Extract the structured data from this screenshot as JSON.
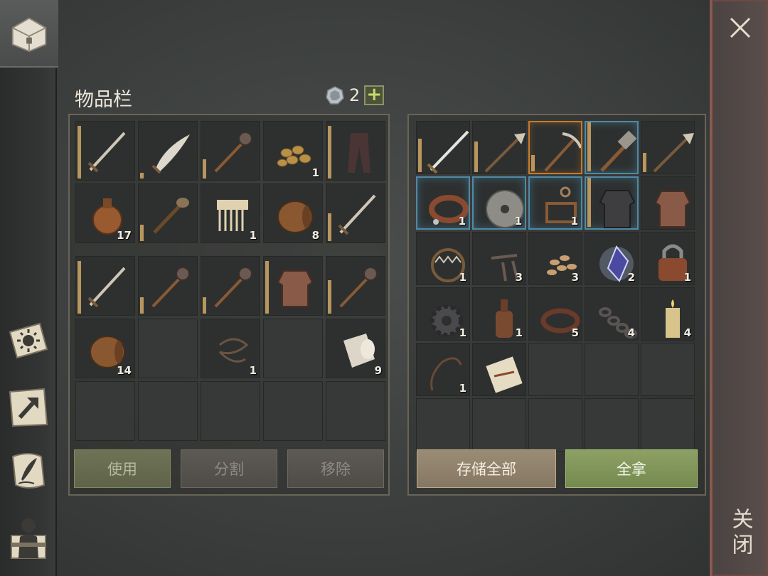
{
  "header": {
    "title": "物品栏",
    "coins": "2",
    "plus_label": "+"
  },
  "close": {
    "label": "关闭"
  },
  "sidebar": {
    "items": [
      {
        "name": "chest-tab",
        "icon": "chest-icon"
      },
      {
        "name": "sidebar-item-events",
        "icon": "sun-book-icon"
      },
      {
        "name": "sidebar-item-crafting",
        "icon": "hammer-scroll-icon"
      },
      {
        "name": "sidebar-item-journal",
        "icon": "quill-scroll-icon"
      },
      {
        "name": "sidebar-item-character",
        "icon": "character-icon"
      }
    ]
  },
  "player": {
    "grid1": [
      {
        "item": "sword",
        "dur": 0.95
      },
      {
        "item": "scimitar",
        "dur": 0.1
      },
      {
        "item": "mace",
        "dur": 0.35
      },
      {
        "item": "coins",
        "qty": "1"
      },
      {
        "item": "pants",
        "dur": 0.95
      },
      {
        "item": "flask",
        "qty": "17"
      },
      {
        "item": "torch",
        "dur": 0.3
      },
      {
        "item": "comb",
        "qty": "1"
      },
      {
        "item": "barrel",
        "qty": "8"
      },
      {
        "item": "sword",
        "dur": 0.5
      }
    ],
    "grid2": [
      {
        "item": "sword",
        "dur": 0.95
      },
      {
        "item": "mace",
        "dur": 0.3
      },
      {
        "item": "mace",
        "dur": 0.3
      },
      {
        "item": "chainmail",
        "dur": 0.95
      },
      {
        "item": "mace",
        "dur": 0.6
      },
      {
        "item": "barrel",
        "qty": "14"
      },
      {
        "item": "empty"
      },
      {
        "item": "rope",
        "qty": "1"
      },
      {
        "item": "empty"
      },
      {
        "item": "cloth",
        "qty": "9"
      },
      {
        "item": "empty"
      },
      {
        "item": "empty"
      },
      {
        "item": "empty"
      },
      {
        "item": "empty"
      },
      {
        "item": "empty"
      }
    ],
    "buttons": {
      "use": "使用",
      "split": "分割",
      "remove": "移除"
    }
  },
  "container": {
    "grid": [
      {
        "item": "longsword",
        "dur": 0.6
      },
      {
        "item": "halberd",
        "dur": 0.55
      },
      {
        "item": "pickaxe",
        "dur": 0.3,
        "frame": "orange"
      },
      {
        "item": "hammer",
        "dur": 0.95,
        "frame": "blue"
      },
      {
        "item": "halberd",
        "dur": 0.35
      },
      {
        "item": "collar",
        "qty": "1",
        "frame": "blue"
      },
      {
        "item": "grindstone",
        "qty": "1",
        "frame": "blue"
      },
      {
        "item": "key-frame",
        "qty": "1",
        "frame": "blue"
      },
      {
        "item": "scale-armor",
        "frame": "blue",
        "dur": 0.95
      },
      {
        "item": "chainmail"
      },
      {
        "item": "trap",
        "qty": "1"
      },
      {
        "item": "nails",
        "qty": "3"
      },
      {
        "item": "seeds",
        "qty": "3"
      },
      {
        "item": "crystal",
        "qty": "2"
      },
      {
        "item": "padlock",
        "qty": "1"
      },
      {
        "item": "gear",
        "qty": "1"
      },
      {
        "item": "bottle",
        "qty": "1"
      },
      {
        "item": "belt",
        "qty": "5"
      },
      {
        "item": "chain",
        "qty": "4"
      },
      {
        "item": "candle",
        "qty": "4"
      },
      {
        "item": "whip",
        "qty": "1"
      },
      {
        "item": "scroll"
      },
      {
        "item": "empty"
      },
      {
        "item": "empty"
      },
      {
        "item": "empty"
      },
      {
        "item": "empty"
      },
      {
        "item": "empty"
      },
      {
        "item": "empty"
      },
      {
        "item": "empty"
      },
      {
        "item": "empty"
      }
    ],
    "buttons": {
      "store_all": "存储全部",
      "take_all": "全拿"
    }
  }
}
